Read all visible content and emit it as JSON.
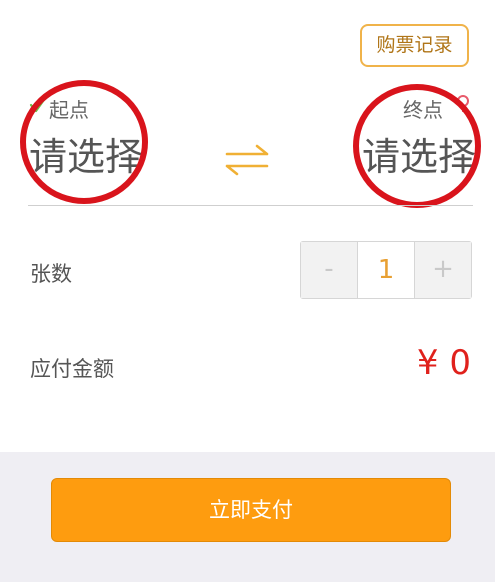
{
  "header": {
    "history_label": "购票记录"
  },
  "route": {
    "from_label": "起点",
    "from_value": "请选择",
    "to_label": "终点",
    "to_value": "请选择"
  },
  "ticket": {
    "count_label": "张数",
    "decrement_label": "-",
    "quantity": "1",
    "increment_label": "+"
  },
  "payment": {
    "amount_label": "应付金额",
    "amount_value": "¥ 0",
    "pay_label": "立即支付"
  },
  "icons": {
    "from_icon": "check-icon",
    "to_icon": "location-pin-icon",
    "swap_icon": "swap-arrows-icon"
  },
  "colors": {
    "accent": "#fe9c0f",
    "price": "#e0211c",
    "annotation": "#d9141c"
  }
}
